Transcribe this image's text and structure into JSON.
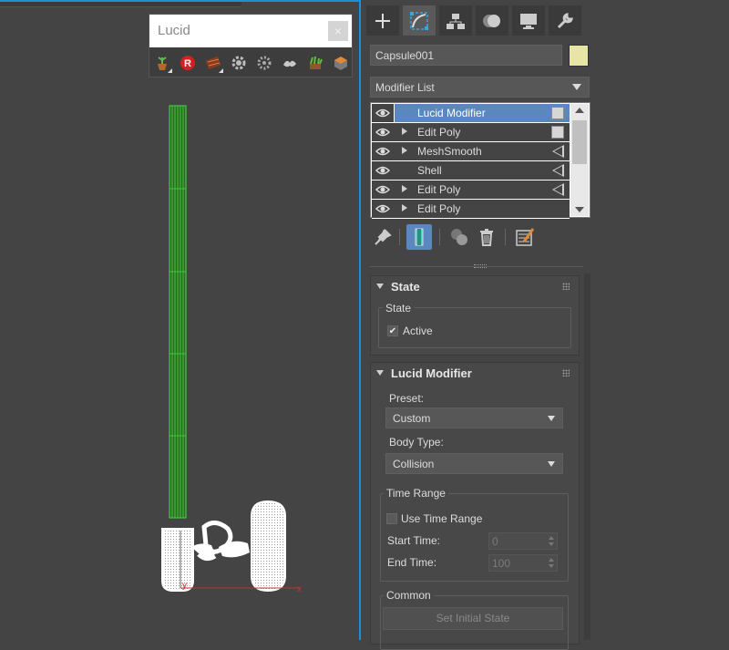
{
  "lucid_toolbar": {
    "title": "Lucid",
    "close": "×",
    "icons": [
      "lucid-planter-icon",
      "lucid-r-icon",
      "lucid-bricks-icon",
      "lucid-gear-icon",
      "lucid-gear-alt-icon",
      "lucid-cloth-icon",
      "lucid-grass-icon",
      "lucid-box-icon"
    ]
  },
  "command_panel": {
    "tabs": [
      "create-tab",
      "modify-tab",
      "hierarchy-tab",
      "motion-tab",
      "display-tab",
      "utilities-tab"
    ],
    "object_name": "Capsule001",
    "object_color": "#e8e4a6",
    "modifier_list_label": "Modifier List",
    "stack": [
      {
        "label": "Lucid Modifier",
        "expand": false,
        "marker": "box",
        "selected": true
      },
      {
        "label": "Edit Poly",
        "expand": true,
        "marker": "box",
        "selected": false
      },
      {
        "label": "MeshSmooth",
        "expand": true,
        "marker": "triangle",
        "selected": false
      },
      {
        "label": "Shell",
        "expand": false,
        "marker": "triangle",
        "selected": false
      },
      {
        "label": "Edit Poly",
        "expand": true,
        "marker": "triangle",
        "selected": false
      },
      {
        "label": "Edit Poly",
        "expand": true,
        "marker": "none",
        "selected": false
      }
    ]
  },
  "state_rollout": {
    "title": "State",
    "group_label": "State",
    "active_label": "Active",
    "active_checked": "✔"
  },
  "lucid_rollout": {
    "title": "Lucid Modifier",
    "preset_label": "Preset:",
    "preset_value": "Custom",
    "body_type_label": "Body Type:",
    "body_type_value": "Collision",
    "time_range_group": "Time Range",
    "use_time_range_label": "Use Time Range",
    "start_time_label": "Start Time:",
    "start_time_value": "0",
    "end_time_label": "End Time:",
    "end_time_value": "100",
    "common_group": "Common",
    "set_initial_state_label": "Set Initial State"
  },
  "colors": {
    "accent": "#1e8fd6",
    "selection": "#5b87c0",
    "wire_green": "#3ec83a"
  }
}
